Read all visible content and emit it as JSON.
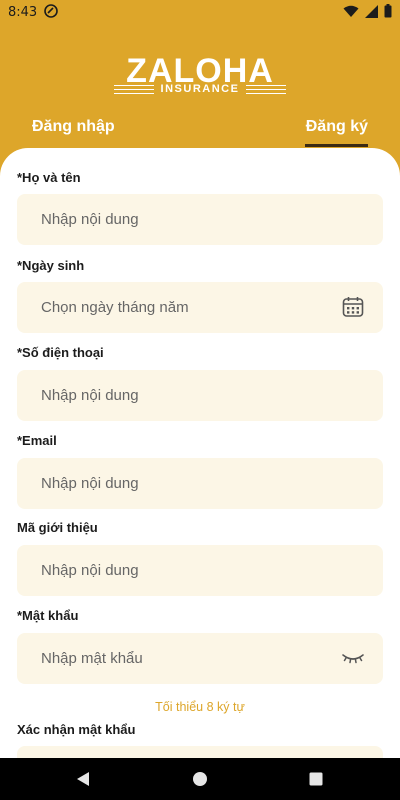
{
  "status_bar": {
    "time": "8:43"
  },
  "logo": {
    "title": "ZALOHA",
    "subtitle": "INSURANCE"
  },
  "tabs": {
    "login": "Đăng nhập",
    "register": "Đăng ký",
    "active": "register"
  },
  "form": {
    "fields": [
      {
        "label": "*Họ và tên",
        "placeholder": "Nhập nội dung"
      },
      {
        "label": "*Ngày sinh",
        "placeholder": "Chọn ngày tháng năm",
        "icon": "calendar-icon"
      },
      {
        "label": "*Số điện thoại",
        "placeholder": "Nhập nội dung"
      },
      {
        "label": "*Email",
        "placeholder": "Nhập nội dung"
      },
      {
        "label": "Mã giới thiệu",
        "placeholder": "Nhập nội dung"
      },
      {
        "label": "*Mật khẩu",
        "placeholder": "Nhập mật khẩu",
        "icon": "eye-closed-icon"
      },
      {
        "label": "Xác nhận mật khẩu",
        "placeholder": ""
      }
    ],
    "password_hint": "Tối thiểu 8 ký tự"
  },
  "colors": {
    "primary": "#DDA62A",
    "field_bg": "#FCF6E6",
    "tab_underline": "#3b2a14"
  }
}
